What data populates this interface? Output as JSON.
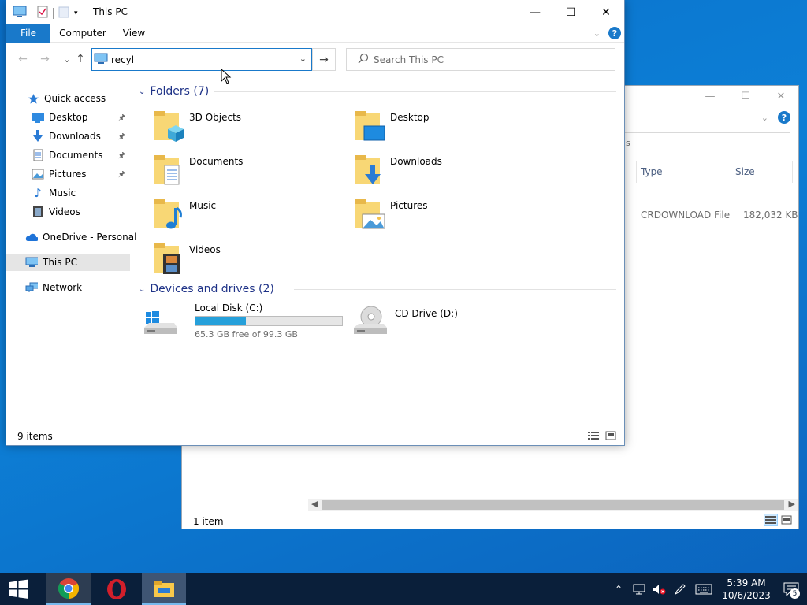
{
  "background_window": {
    "search_text_fragment": "s",
    "columns": [
      "Type",
      "Size"
    ],
    "row": {
      "type": "CRDOWNLOAD File",
      "size": "182,032 KB"
    },
    "status": "1 item"
  },
  "window": {
    "title": "This PC",
    "tabs": [
      "File",
      "Computer",
      "View"
    ],
    "address_value": "recyl",
    "search_placeholder": "Search This PC",
    "status": "9 items"
  },
  "sidebar": {
    "items": [
      {
        "label": "Quick access",
        "icon": "star-icon"
      },
      {
        "label": "Desktop",
        "icon": "desktop-icon",
        "pinned": true
      },
      {
        "label": "Downloads",
        "icon": "download-arrow-icon",
        "pinned": true
      },
      {
        "label": "Documents",
        "icon": "document-icon",
        "pinned": true
      },
      {
        "label": "Pictures",
        "icon": "pictures-icon",
        "pinned": true
      },
      {
        "label": "Music",
        "icon": "music-note-icon"
      },
      {
        "label": "Videos",
        "icon": "film-icon"
      },
      {
        "label": "OneDrive - Personal",
        "icon": "cloud-icon"
      },
      {
        "label": "This PC",
        "icon": "computer-icon",
        "selected": true
      },
      {
        "label": "Network",
        "icon": "network-icon"
      }
    ]
  },
  "groups": {
    "folders_header": "Folders (7)",
    "drives_header": "Devices and drives (2)"
  },
  "folders": [
    {
      "name": "3D Objects",
      "icon": "cube-folder-icon"
    },
    {
      "name": "Desktop",
      "icon": "desktop-folder-icon"
    },
    {
      "name": "Documents",
      "icon": "documents-folder-icon"
    },
    {
      "name": "Downloads",
      "icon": "downloads-folder-icon"
    },
    {
      "name": "Music",
      "icon": "music-folder-icon"
    },
    {
      "name": "Pictures",
      "icon": "pictures-folder-icon"
    },
    {
      "name": "Videos",
      "icon": "videos-folder-icon"
    }
  ],
  "drives": [
    {
      "name": "Local Disk (C:)",
      "free_text": "65.3 GB free of 99.3 GB",
      "used_fraction": 0.342,
      "icon": "windows-drive-icon"
    },
    {
      "name": "CD Drive (D:)",
      "icon": "cd-drive-icon"
    }
  ],
  "taskbar": {
    "apps": [
      "Chrome",
      "Opera",
      "File Explorer"
    ],
    "time": "5:39 AM",
    "date": "10/6/2023",
    "notification_count": "5"
  },
  "colors": {
    "accent": "#1979ca",
    "folder_yellow": "#f8d775",
    "progress": "#26a0da",
    "taskbar": "#0a1f3a"
  }
}
